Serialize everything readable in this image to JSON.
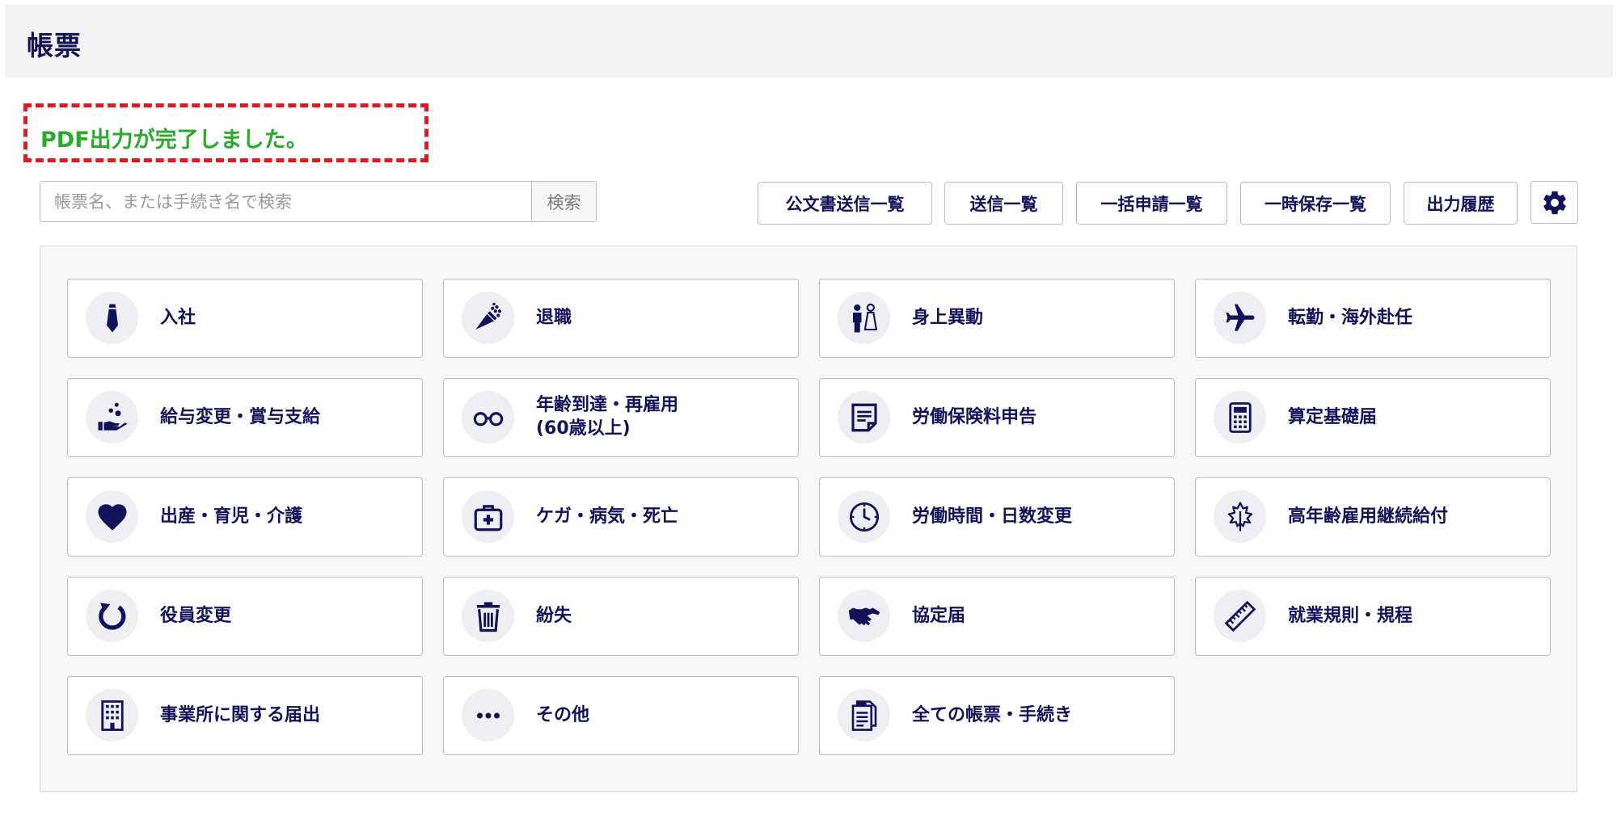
{
  "header": {
    "title": "帳票"
  },
  "notice": {
    "message": "PDF出力が完了しました。"
  },
  "search": {
    "placeholder": "帳票名、または手続き名で検索",
    "button": "検索"
  },
  "toolbar": {
    "buttons": [
      "公文書送信一覧",
      "送信一覧",
      "一括申請一覧",
      "一時保存一覧",
      "出力履歴"
    ]
  },
  "colors": {
    "accent": "#12125a",
    "success": "#2aaa2a",
    "alert_border": "#e0181f"
  },
  "categories": [
    {
      "label": "入社",
      "icon": "necktie-icon"
    },
    {
      "label": "退職",
      "icon": "bouquet-icon"
    },
    {
      "label": "身上異動",
      "icon": "wedding-couple-icon"
    },
    {
      "label": "転勤・海外赴任",
      "icon": "airplane-icon"
    },
    {
      "label": "給与変更・賞与支給",
      "icon": "hand-coins-icon"
    },
    {
      "label": "年齢到達・再雇用\n(60歳以上)",
      "icon": "glasses-icon"
    },
    {
      "label": "労働保険料申告",
      "icon": "document-lines-icon"
    },
    {
      "label": "算定基礎届",
      "icon": "calculator-icon"
    },
    {
      "label": "出産・育児・介護",
      "icon": "heart-icon"
    },
    {
      "label": "ケガ・病気・死亡",
      "icon": "medical-kit-icon"
    },
    {
      "label": "労働時間・日数変更",
      "icon": "clock-icon"
    },
    {
      "label": "高年齢雇用継続給付",
      "icon": "maple-leaf-icon"
    },
    {
      "label": "役員変更",
      "icon": "refresh-arrow-icon"
    },
    {
      "label": "紛失",
      "icon": "trash-icon"
    },
    {
      "label": "協定届",
      "icon": "handshake-icon"
    },
    {
      "label": "就業規則・規程",
      "icon": "ruler-icon"
    },
    {
      "label": "事業所に関する届出",
      "icon": "building-icon"
    },
    {
      "label": "その他",
      "icon": "more-dots-icon"
    },
    {
      "label": "全ての帳票・手続き",
      "icon": "documents-icon"
    }
  ]
}
